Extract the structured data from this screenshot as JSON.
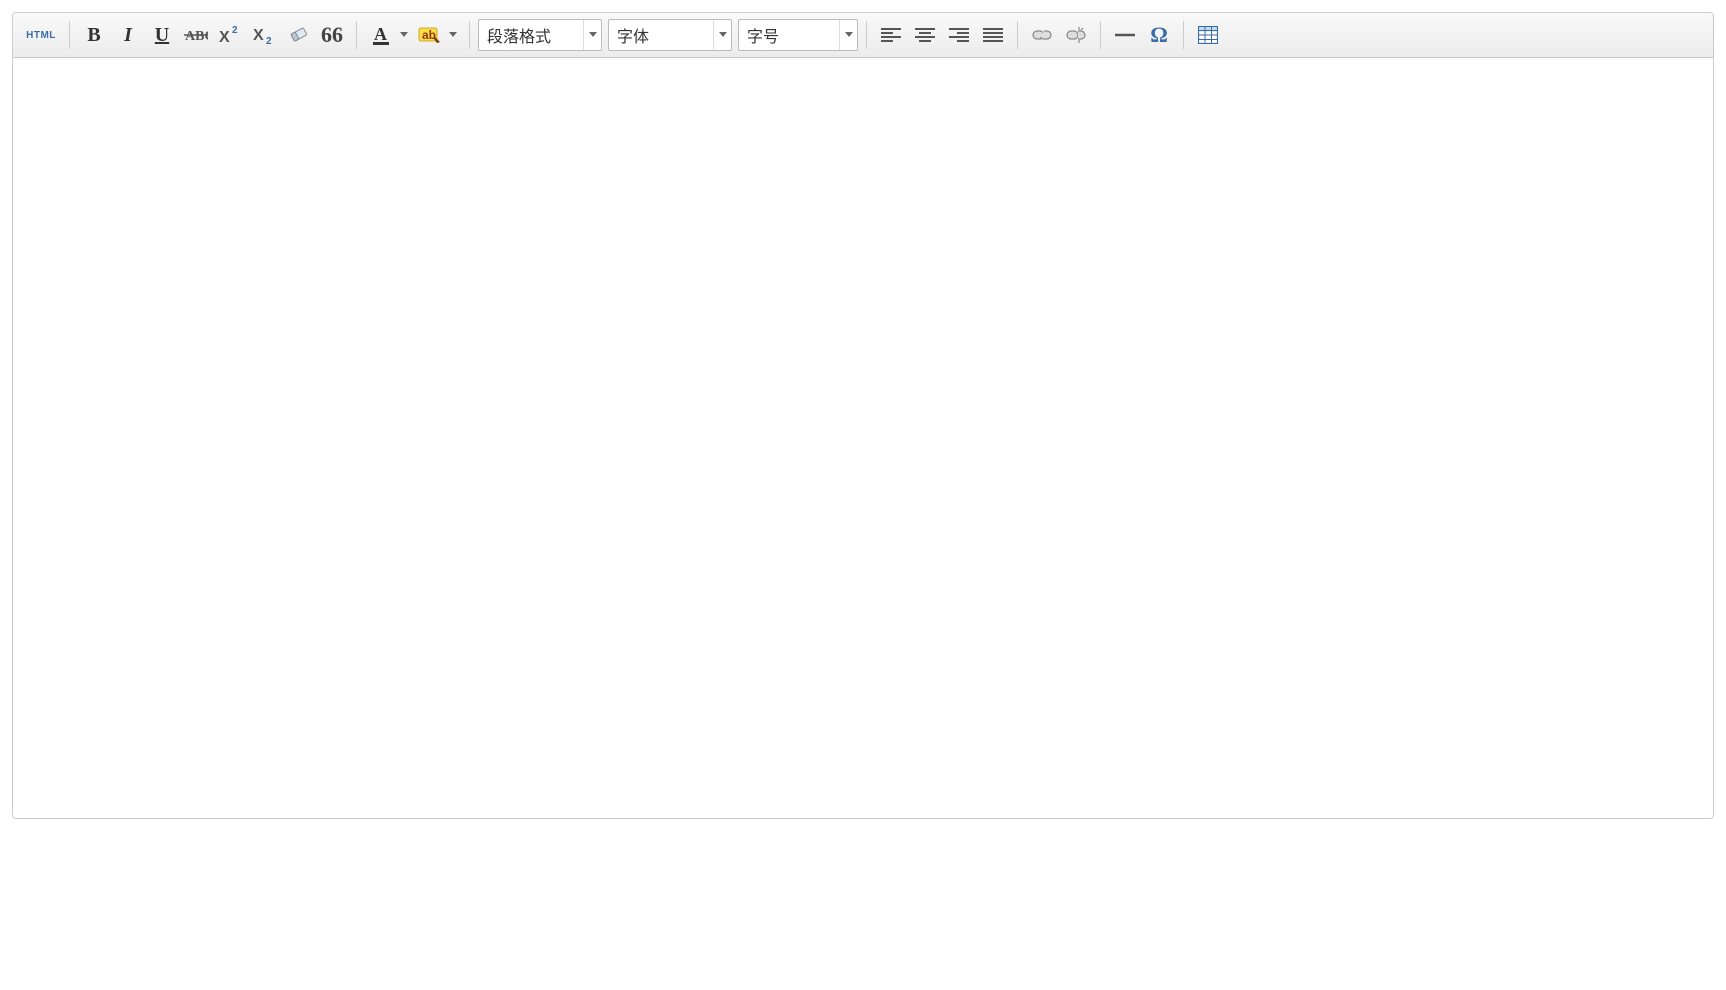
{
  "toolbar": {
    "html_label": "HTML",
    "bold_letter": "B",
    "italic_letter": "I",
    "underline_letter": "U",
    "fontcolor_letter": "A",
    "highlight_text": "ab",
    "omega": "Ω",
    "selects": {
      "format": "段落格式",
      "fontface": "字体",
      "fontsize": "字号"
    }
  },
  "content": ""
}
